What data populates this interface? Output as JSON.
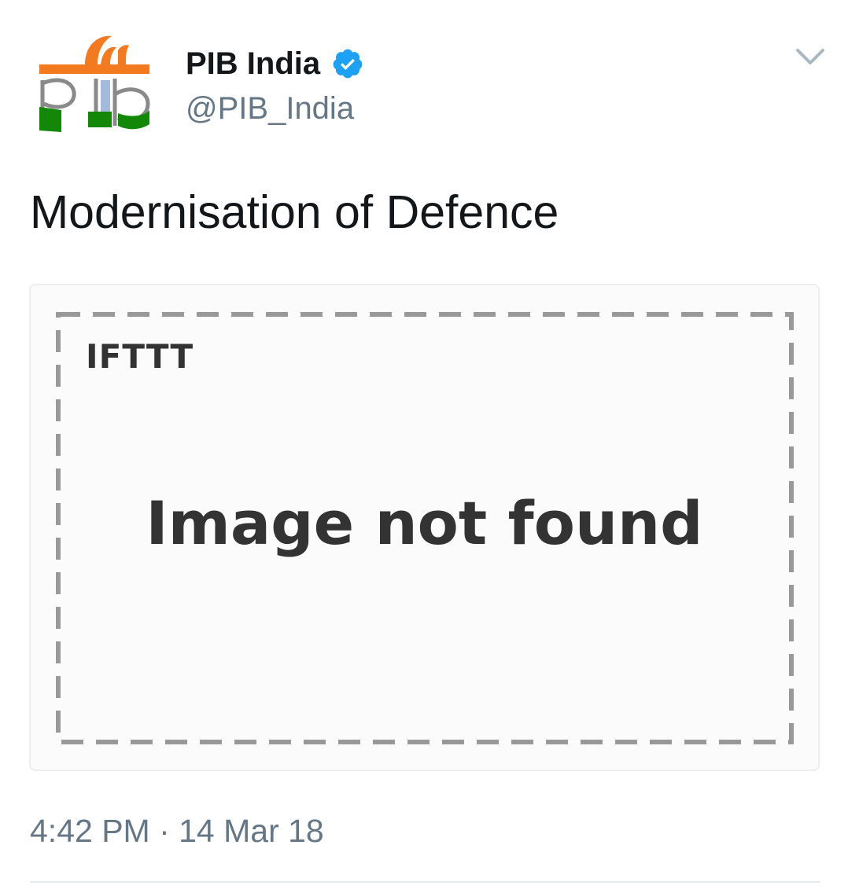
{
  "author": {
    "display_name": "PIB India",
    "handle": "@PIB_India",
    "verified": true,
    "avatar_icon": "pib-logo-icon"
  },
  "tweet": {
    "text": "Modernisation of Defence",
    "timestamp": "4:42 PM · 14 Mar 18"
  },
  "media": {
    "brand": "IFTTT",
    "message": "Image not found"
  },
  "colors": {
    "verified_blue": "#1da1f2",
    "secondary_text": "#657786",
    "saffron": "#f47a20",
    "green": "#138808"
  }
}
